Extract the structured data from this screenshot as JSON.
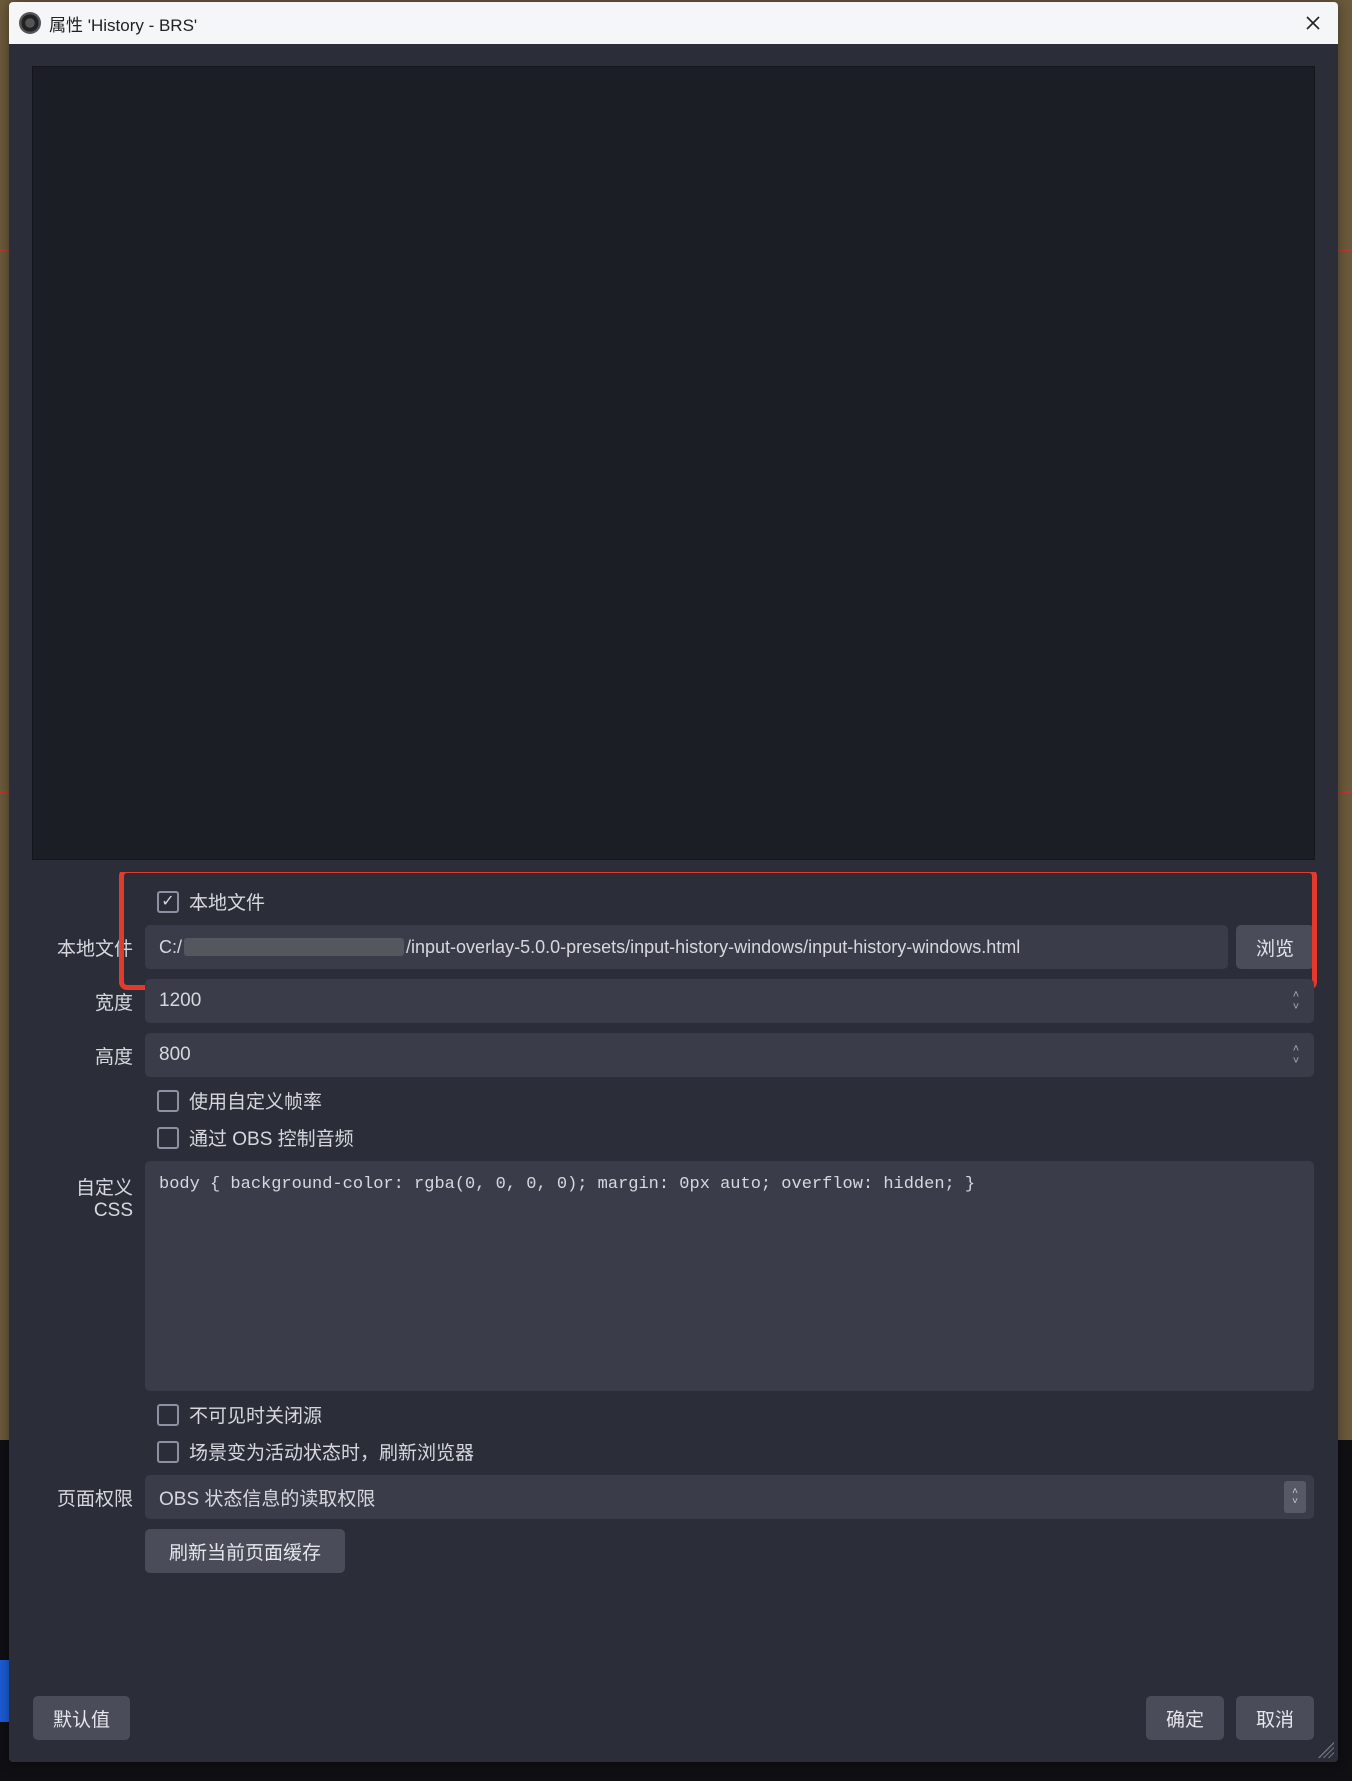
{
  "window": {
    "title": "属性 'History - BRS'"
  },
  "localFile": {
    "checkboxLabel": "本地文件",
    "label": "本地文件",
    "pathPrefix": "C:/",
    "pathSuffix": "/input-overlay-5.0.0-presets/input-history-windows/input-history-windows.html",
    "browseLabel": "浏览"
  },
  "width": {
    "label": "宽度",
    "value": "1200"
  },
  "height": {
    "label": "高度",
    "value": "800"
  },
  "customFps": {
    "label": "使用自定义帧率"
  },
  "controlAudio": {
    "label": "通过 OBS 控制音频"
  },
  "customCss": {
    "label": "自定义 CSS",
    "value": "body { background-color: rgba(0, 0, 0, 0); margin: 0px auto; overflow: hidden; }"
  },
  "shutdown": {
    "label": "不可见时关闭源"
  },
  "refreshOnActive": {
    "label": "场景变为活动状态时，刷新浏览器"
  },
  "pagePerm": {
    "label": "页面权限",
    "value": "OBS 状态信息的读取权限"
  },
  "refreshCache": {
    "label": "刷新当前页面缓存"
  },
  "footer": {
    "defaults": "默认值",
    "ok": "确定",
    "cancel": "取消"
  }
}
